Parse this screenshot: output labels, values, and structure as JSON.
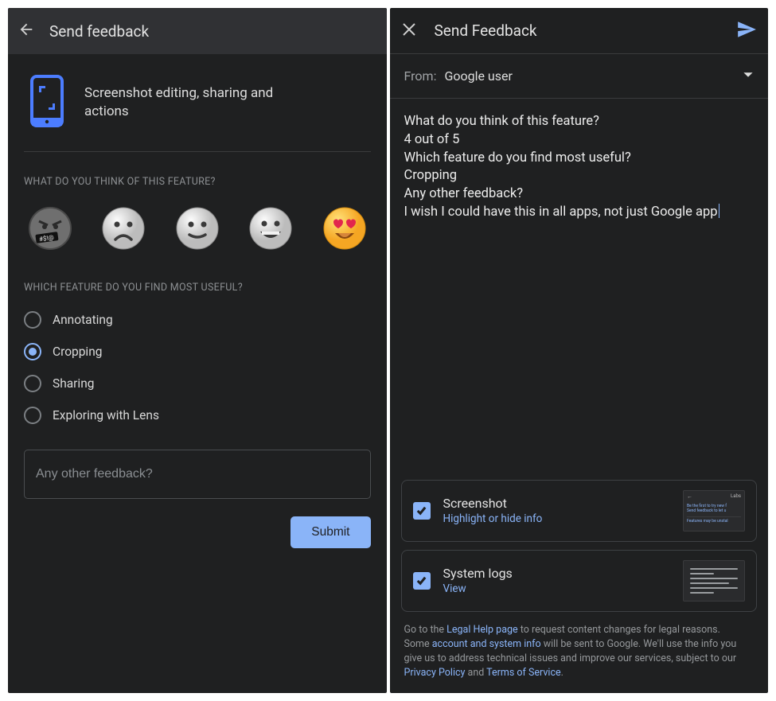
{
  "left": {
    "header_title": "Send feedback",
    "hero_text": "Screenshot editing, sharing and actions",
    "q1": "WHAT DO YOU THINK OF THIS FEATURE?",
    "q2": "WHICH FEATURE DO YOU FIND MOST USEFUL?",
    "options": [
      "Annotating",
      "Cropping",
      "Sharing",
      "Exploring with Lens"
    ],
    "selected_option_index": 1,
    "textarea_placeholder": "Any other feedback?",
    "submit_label": "Submit"
  },
  "right": {
    "header_title": "Send Feedback",
    "from_label": "From:",
    "from_value": "Google user",
    "message": "What do you think of this feature?\n4 out of 5\nWhich feature do you find most useful?\nCropping\nAny other feedback?\nI wish I could have this in all apps, not just Google app",
    "attachments": {
      "screenshot": {
        "title": "Screenshot",
        "subtitle": "Highlight or hide info",
        "thumb_labs": "Labs",
        "thumb_line1": "Be the first to try new f",
        "thumb_line2": "Send feedback to let u",
        "thumb_line3": "Features may be unstal"
      },
      "systemlogs": {
        "title": "System logs",
        "subtitle": "View"
      }
    },
    "legal": {
      "pre1": "Go to the ",
      "link1": "Legal Help page",
      "post1": " to request content changes for legal reasons.",
      "pre2": "Some ",
      "link2": "account and system info",
      "post2": " will be sent to Google. We'll use the info you give us to address technical issues and improve our services, subject to our ",
      "link3": "Privacy Policy",
      "and": " and ",
      "link4": "Terms of Service",
      "dot": "."
    }
  }
}
